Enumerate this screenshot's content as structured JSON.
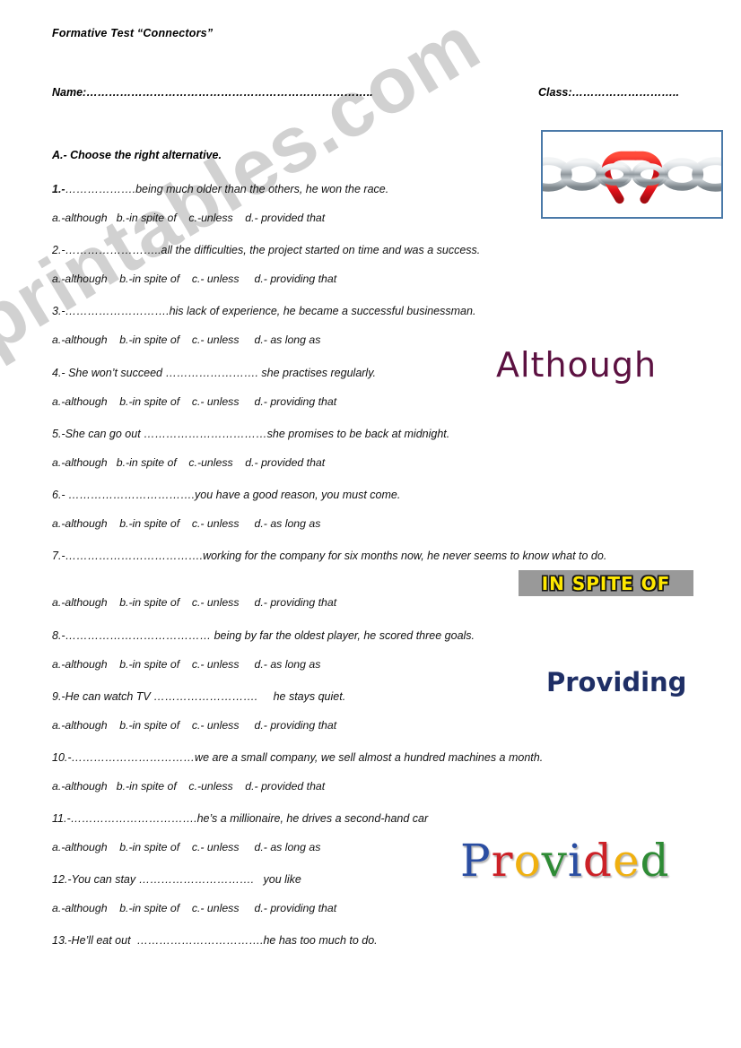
{
  "document": {
    "title": "Formative Test “Connectors”",
    "name_label": "Name:…………………………………………………………………..",
    "class_label": "Class:………………………..",
    "section_heading": "A.- Choose the right alternative."
  },
  "questions": [
    {
      "number": "1.-",
      "text": "……………….being much older than the others, he won the race.",
      "options": "a.-although   b.-in spite of    c.-unless    d.- provided that"
    },
    {
      "number": "2.-",
      "text": "……………………..all the difficulties, the project started on time and was a success.",
      "options": "a.-although    b.-in spite of    c.- unless     d.- providing that"
    },
    {
      "number": "3.-",
      "text": "……………………….his lack of experience, he became a successful businessman.",
      "options": "a.-although    b.-in spite of    c.- unless     d.- as long as"
    },
    {
      "number": "4.- ",
      "text": "She won’t succeed ……………………. she practises regularly.",
      "options": "a.-although    b.-in spite of    c.- unless     d.- providing that"
    },
    {
      "number": "5.-",
      "text": "She can go out ……………………………she promises to be back at midnight.",
      "options": "a.-although   b.-in spite of    c.-unless    d.- provided that"
    },
    {
      "number": "6.- ",
      "text": "…………………………….you have a good reason, you must come.",
      "options": "a.-although    b.-in spite of    c.- unless     d.- as long as"
    },
    {
      "number": "7.-",
      "text": "……………………………….working for the company for six months now, he never seems to know what to do.",
      "options": "a.-although    b.-in spite of    c.- unless     d.- providing that"
    },
    {
      "number": "8.-",
      "text": "………………………………… being by far the oldest player, he scored three goals.",
      "options": "a.-although    b.-in spite of    c.- unless     d.- as long as"
    },
    {
      "number": "9.-",
      "text": "He can watch TV ……………………….     he stays quiet.",
      "options": "a.-although    b.-in spite of    c.- unless     d.- providing that"
    },
    {
      "number": "10.-",
      "text": "……………………………we are a small company, we sell almost a hundred machines a month.",
      "options": "a.-although   b.-in spite of    c.-unless    d.- provided that"
    },
    {
      "number": "11.-",
      "text": "…………………………….he’s a millionaire, he drives a second-hand car",
      "options": "a.-although    b.-in spite of    c.- unless     d.- as long as"
    },
    {
      "number": "12.-",
      "text": "You can stay ………………………….   you like",
      "options": "a.-although    b.-in spite of    c.- unless     d.- providing that"
    },
    {
      "number": "13.-",
      "text": "He’ll eat out  …………………………….he has too much to do.",
      "options": ""
    }
  ],
  "decorations": {
    "wordart_although": "Although",
    "wordart_in_spite_of": "IN SPITE OF",
    "wordart_providing": "Providing",
    "wordart_provided_letters": [
      "P",
      "r",
      "o",
      "v",
      "i",
      "d",
      "e",
      "d"
    ],
    "chain_image_alt": "broken-chain-link-photo"
  },
  "watermark": {
    "text": "ESLprintables.com"
  },
  "colors": {
    "although": "#5c1141",
    "in_spite_of_text": "#ffe800",
    "in_spite_of_bg": "#999999",
    "providing": "#1f2f66",
    "chain_frame": "#4a79a8",
    "watermark": "#c9c9c9",
    "provided_blue": "#2b4ea2",
    "provided_red": "#cc2127",
    "provided_yellow": "#f0b010",
    "provided_green": "#2e8b35"
  }
}
